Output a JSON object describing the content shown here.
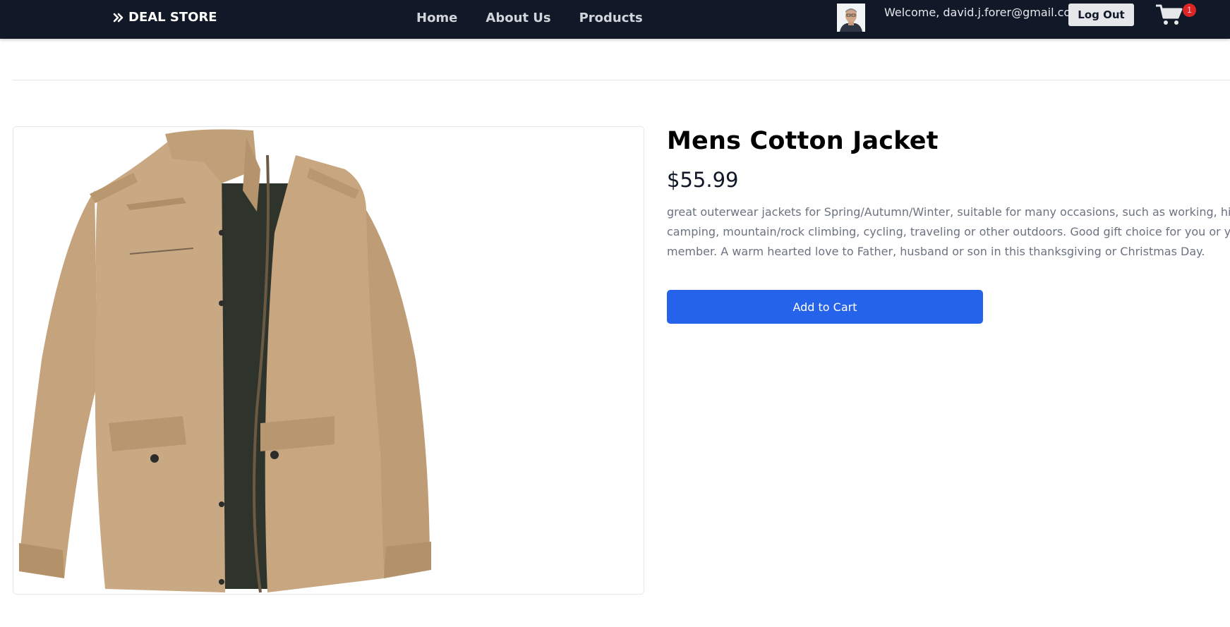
{
  "navbar": {
    "brand": "DEAL STORE",
    "links": [
      "Home",
      "About Us",
      "Products"
    ],
    "welcome_text": "Welcome, david.j.forer@gmail.com",
    "logout_label": "Log Out",
    "cart_count": "1"
  },
  "product": {
    "title": "Mens Cotton Jacket",
    "price": "$55.99",
    "description_lines": [
      "great outerwear jackets for Spring/Autumn/Winter, suitable for many occasions, such as working, hik",
      "camping, mountain/rock climbing, cycling, traveling or other outdoors. Good gift choice for you or yo",
      "member. A warm hearted love to Father, husband or son in this thanksgiving or Christmas Day."
    ],
    "add_to_cart_label": "Add to Cart",
    "jacket_color": "#c9a983"
  },
  "colors": {
    "navbar_bg": "#111827",
    "primary_button": "#2563eb",
    "badge": "#dc2626"
  }
}
